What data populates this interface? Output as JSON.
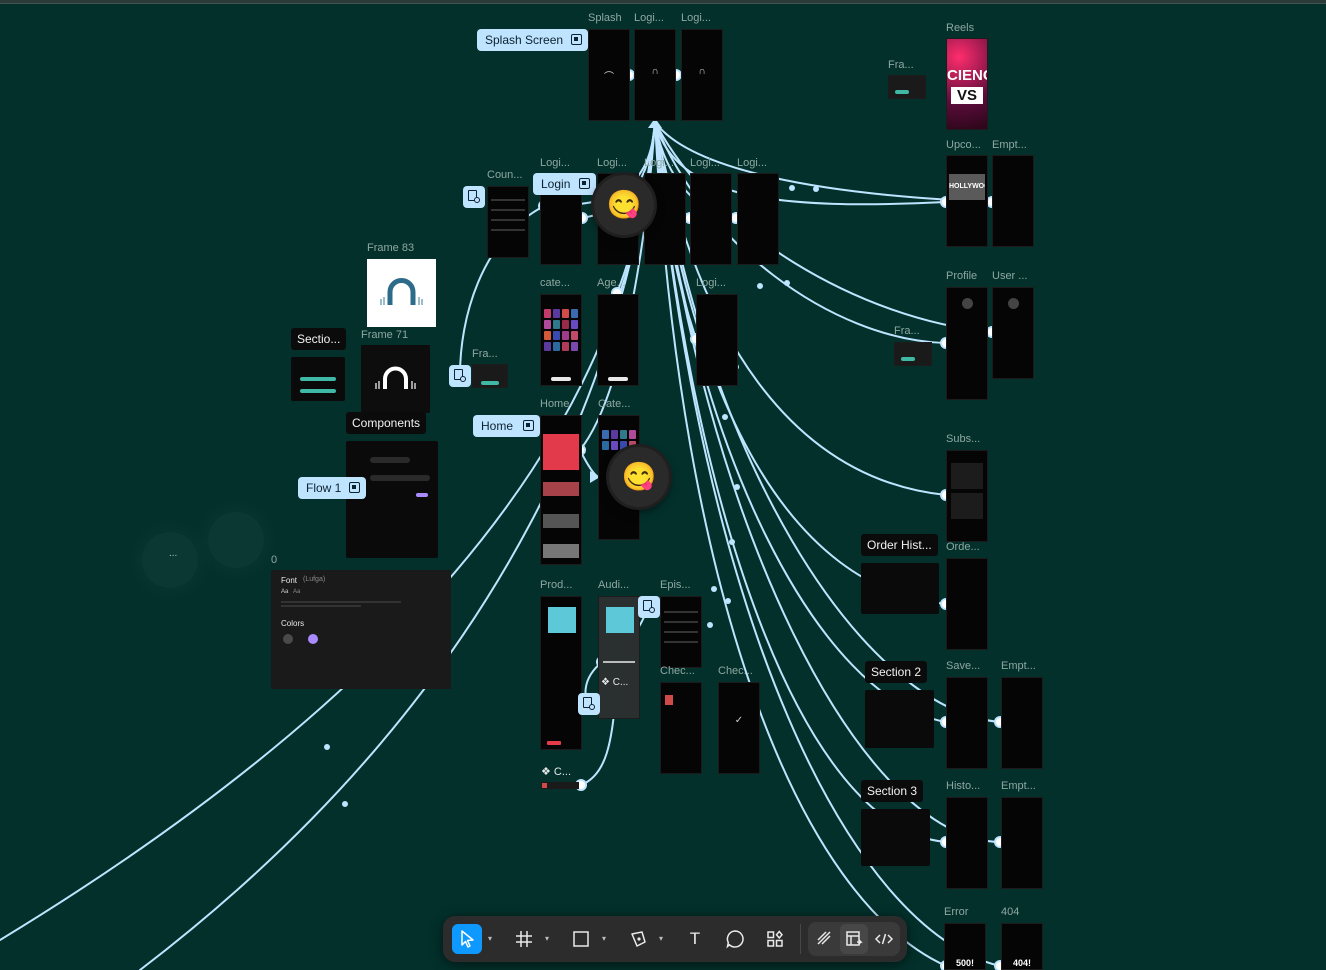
{
  "frame_titles": {
    "splash": "Splash",
    "logi_top_1": "Logi...",
    "logi_top_2": "Logi...",
    "reels": "Reels",
    "fra_top_right": "Fra...",
    "upco": "Upco...",
    "empt_1": "Empt...",
    "coun": "Coun...",
    "logi_mid_1": "Logi...",
    "logi_mid_2": "Logi...",
    "logi_mid_3": "Logi...",
    "logi_mid_4": "Logi...",
    "logi_mid_5": "Logi...",
    "frame83": "Frame 83",
    "frame71": "Frame 71",
    "cate": "cate...",
    "age": "Age...",
    "logi_row3": "Logi...",
    "profile": "Profile",
    "user": "User ...",
    "fra_left": "Fra...",
    "fra_right": "Fra...",
    "home": "Home",
    "cate2": "Cate...",
    "subs": "Subs...",
    "orde": "Orde...",
    "zero": "0",
    "prod": "Prod...",
    "audi": "Audi...",
    "epis": "Epis...",
    "chec1": "Chec...",
    "chec2": "Chec...",
    "save": "Save...",
    "empt_2": "Empt...",
    "histo": "Histo...",
    "empt_3": "Empt...",
    "error": "Error",
    "err404": "404"
  },
  "flow_chips": {
    "splash": "Splash Screen",
    "login": "Login",
    "home": "Home",
    "flow1": "Flow 1"
  },
  "sections": {
    "sectio": "Sectio...",
    "components": "Components",
    "order_hist": "Order Hist...",
    "section2": "Section 2",
    "section3": "Section 3"
  },
  "component_labels": {
    "c_a": "C...",
    "c_b": "C...",
    "ellipsis": "..."
  },
  "style_card": {
    "font_label": "Font",
    "font_name": "(Lufga)",
    "aa_1": "Aa",
    "aa_2": "Aa",
    "colors_label": "Colors",
    "swatches": [
      "#4a4a4a",
      "#a98bff"
    ]
  },
  "error_texts": {
    "error_code": "500!",
    "not_found": "404!"
  },
  "reels_art": {
    "line1": "CIENC",
    "line2": "VS"
  },
  "upcoming_art": "HOLLYWOOD",
  "cursor_emoji": "😋",
  "toolbar": {
    "move": "move-tool",
    "frame": "frame-tool",
    "shape": "rectangle-tool",
    "pen": "pen-tool",
    "text_glyph": "T",
    "comment": "comment-tool",
    "actions": "actions-tool",
    "draw": "draw-mode",
    "dev": "dev-mode",
    "code": "code-view"
  },
  "colors": {
    "canvas": "#03302b",
    "connector": "#bfe4ff",
    "selected_tool": "#0d99ff",
    "frame_bg": "#050505"
  }
}
